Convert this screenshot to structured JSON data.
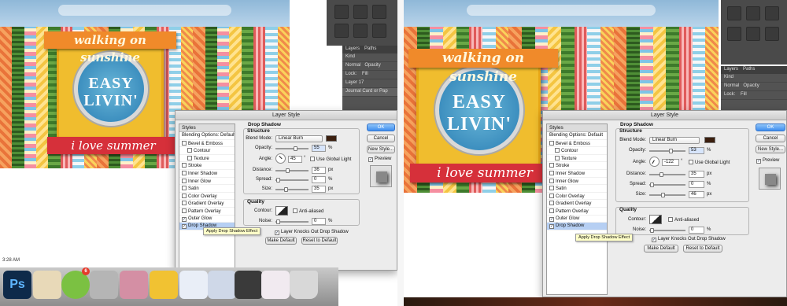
{
  "app": {
    "name": "Photoshop"
  },
  "card": {
    "top_banner": "walking on sunshine",
    "circle_line1": "EASY",
    "circle_line2": "LIVIN'",
    "bottom_banner": "i love summer"
  },
  "layers_panel": {
    "tabs": [
      "Layers",
      "Paths"
    ],
    "kind_label": "Kind",
    "blend": "Normal",
    "opacity_label": "Opacity",
    "lock_label": "Lock:",
    "fill_label": "Fill",
    "layer1": "Layer 17",
    "layer2": "Journal Card or Pap"
  },
  "dialog": {
    "title": "Layer Style",
    "styles_header": "Styles",
    "style_items": [
      {
        "label": "Blending Options: Default",
        "checkbox": false,
        "checked": false,
        "indent": false
      },
      {
        "label": "Bevel & Emboss",
        "checkbox": true,
        "checked": false,
        "indent": false
      },
      {
        "label": "Contour",
        "checkbox": true,
        "checked": false,
        "indent": true
      },
      {
        "label": "Texture",
        "checkbox": true,
        "checked": false,
        "indent": true
      },
      {
        "label": "Stroke",
        "checkbox": true,
        "checked": false,
        "indent": false
      },
      {
        "label": "Inner Shadow",
        "checkbox": true,
        "checked": false,
        "indent": false
      },
      {
        "label": "Inner Glow",
        "checkbox": true,
        "checked": false,
        "indent": false
      },
      {
        "label": "Satin",
        "checkbox": true,
        "checked": false,
        "indent": false
      },
      {
        "label": "Color Overlay",
        "checkbox": true,
        "checked": false,
        "indent": false
      },
      {
        "label": "Gradient Overlay",
        "checkbox": true,
        "checked": false,
        "indent": false
      },
      {
        "label": "Pattern Overlay",
        "checkbox": true,
        "checked": false,
        "indent": false
      },
      {
        "label": "Outer Glow",
        "checkbox": true,
        "checked": true,
        "indent": false
      },
      {
        "label": "Drop Shadow",
        "checkbox": true,
        "checked": true,
        "indent": false
      }
    ],
    "section_title": "Drop Shadow",
    "structure_title": "Structure",
    "blend_mode_label": "Blend Mode:",
    "blend_mode_value": "Linear Burn",
    "opacity_label": "Opacity:",
    "angle_label": "Angle:",
    "use_global_light": "Use Global Light",
    "distance_label": "Distance:",
    "spread_label": "Spread:",
    "size_label": "Size:",
    "quality_title": "Quality",
    "contour_label": "Contour:",
    "anti_aliased": "Anti-aliased",
    "noise_label": "Noise:",
    "knockout": "Layer Knocks Out Drop Shadow",
    "make_default": "Make Default",
    "reset_default": "Reset to Default",
    "ok": "OK",
    "cancel": "Cancel",
    "new_style": "New Style...",
    "preview": "Preview",
    "tooltip": "Apply Drop Shadow Effect",
    "unit_pct": "%",
    "unit_px": "px",
    "unit_deg": "°"
  },
  "left_values": {
    "opacity": "55",
    "angle": "45",
    "distance": "36",
    "spread": "0",
    "size": "35",
    "noise": "0"
  },
  "right_values": {
    "opacity": "53",
    "angle": "-122",
    "distance": "35",
    "spread": "0",
    "size": "46",
    "noise": "0"
  },
  "dock": {
    "time": "3:28 AM",
    "ps_label": "Ps",
    "spotify_badge": "6"
  },
  "colors": {
    "ok_button": "#3e8ef0",
    "banner_red": "#d6303a",
    "banner_orange": "#f08a2a",
    "card_yellow": "#f0bd2e",
    "circle_blue": "#3d8fbf"
  }
}
